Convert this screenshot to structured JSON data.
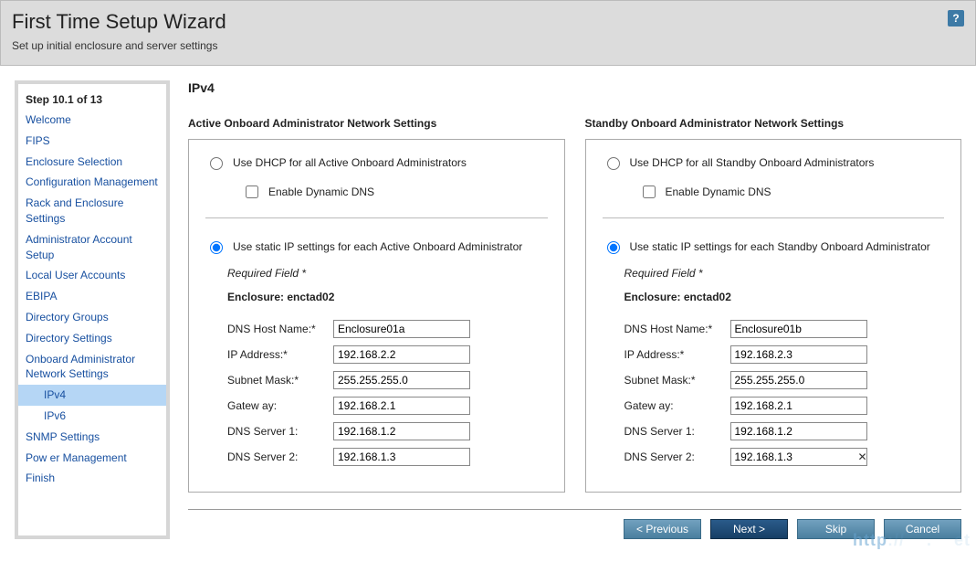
{
  "header": {
    "title": "First Time Setup Wizard",
    "subtitle": "Set up initial enclosure and server settings",
    "help_tooltip": "?"
  },
  "sidebar": {
    "step_label": "Step 10.1 of 13",
    "items": [
      {
        "label": "Welcome"
      },
      {
        "label": "FIPS"
      },
      {
        "label": "Enclosure Selection"
      },
      {
        "label": "Configuration Management"
      },
      {
        "label": "Rack and Enclosure Settings"
      },
      {
        "label": "Administrator Account Setup"
      },
      {
        "label": "Local User Accounts"
      },
      {
        "label": "EBIPA"
      },
      {
        "label": "Directory Groups"
      },
      {
        "label": "Directory Settings"
      },
      {
        "label": "Onboard Administrator Network Settings"
      },
      {
        "label": "IPv4",
        "sub": true,
        "selected": true
      },
      {
        "label": "IPv6",
        "sub": true
      },
      {
        "label": "SNMP Settings"
      },
      {
        "label": "Pow er Management"
      },
      {
        "label": "Finish"
      }
    ]
  },
  "page": {
    "title": "IPv4"
  },
  "active": {
    "panel_title": "Active Onboard Administrator Network Settings",
    "dhcp_label": "Use DHCP for all Active Onboard Administrators",
    "ddns_label": "Enable Dynamic DNS",
    "static_label": "Use static IP settings for each Active Onboard Administrator",
    "static_selected": true,
    "required_label": "Required Field *",
    "enclosure_label": "Enclosure: enctad02",
    "fields": {
      "dns_host_label": "DNS Host Name:*",
      "dns_host_value": "Enclosure01a",
      "ip_label": "IP Address:*",
      "ip_value": "192.168.2.2",
      "mask_label": "Subnet Mask:*",
      "mask_value": "255.255.255.0",
      "gw_label": "Gatew ay:",
      "gw_value": "192.168.2.1",
      "dns1_label": "DNS Server 1:",
      "dns1_value": "192.168.1.2",
      "dns2_label": "DNS Server 2:",
      "dns2_value": "192.168.1.3"
    }
  },
  "standby": {
    "panel_title": "Standby Onboard Administrator Network Settings",
    "dhcp_label": "Use DHCP for all Standby Onboard Administrators",
    "ddns_label": "Enable Dynamic DNS",
    "static_label": "Use static IP settings for each Standby Onboard Administrator",
    "static_selected": true,
    "required_label": "Required Field *",
    "enclosure_label": "Enclosure: enctad02",
    "fields": {
      "dns_host_label": "DNS Host Name:*",
      "dns_host_value": "Enclosure01b",
      "ip_label": "IP Address:*",
      "ip_value": "192.168.2.3",
      "mask_label": "Subnet Mask:*",
      "mask_value": "255.255.255.0",
      "gw_label": "Gatew ay:",
      "gw_value": "192.168.2.1",
      "dns1_label": "DNS Server 1:",
      "dns1_value": "192.168.1.2",
      "dns2_label": "DNS Server 2:",
      "dns2_value": "192.168.1.3",
      "dns2_has_clear": true
    }
  },
  "footer": {
    "previous": "< Previous",
    "next": "Next >",
    "skip": "Skip",
    "cancel": "Cancel"
  },
  "watermark": "http"
}
